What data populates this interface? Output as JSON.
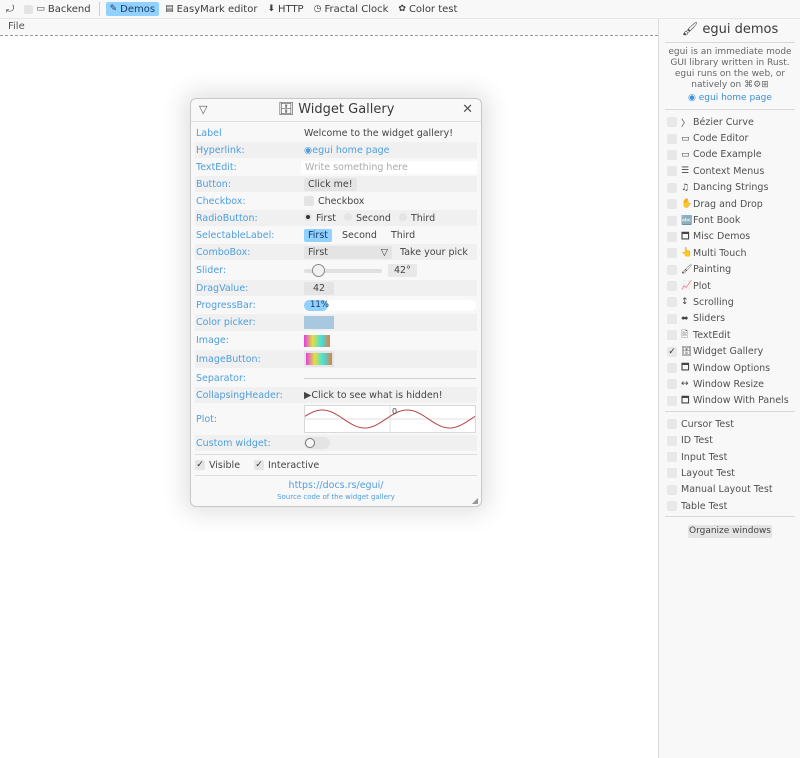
{
  "topbar": {
    "undo_icon": "undo-icon",
    "items": [
      {
        "label": "Backend",
        "icon": "laptop-icon"
      },
      {
        "label": "Demos",
        "icon": "tag-icon",
        "active": true
      },
      {
        "label": "EasyMark editor",
        "icon": "doc-icon"
      },
      {
        "label": "HTTP",
        "icon": "download-icon"
      },
      {
        "label": "Fractal Clock",
        "icon": "clock-icon"
      },
      {
        "label": "Color test",
        "icon": "palette-icon"
      }
    ]
  },
  "menubar": {
    "file": "File"
  },
  "sidepanel": {
    "title": "egui demos",
    "desc1": "egui is an immediate mode",
    "desc2": "GUI library written in Rust.",
    "desc3": "egui runs on the web, or",
    "desc4": "natively on",
    "link": "egui home page",
    "demos": [
      {
        "icon": "〉",
        "label": "Bézier Curve",
        "checked": false
      },
      {
        "icon": "▭",
        "label": "Code Editor",
        "checked": false
      },
      {
        "icon": "▭",
        "label": "Code Example",
        "checked": false
      },
      {
        "icon": "☰",
        "label": "Context Menus",
        "checked": false
      },
      {
        "icon": "♫",
        "label": "Dancing Strings",
        "checked": false
      },
      {
        "icon": "✋",
        "label": "Drag and Drop",
        "checked": false
      },
      {
        "icon": "🔤",
        "label": "Font Book",
        "checked": false
      },
      {
        "icon": "🗖",
        "label": "Misc Demos",
        "checked": false
      },
      {
        "icon": "👆",
        "label": "Multi Touch",
        "checked": false
      },
      {
        "icon": "🖌",
        "label": "Painting",
        "checked": false
      },
      {
        "icon": "📈",
        "label": "Plot",
        "checked": false
      },
      {
        "icon": "↕",
        "label": "Scrolling",
        "checked": false
      },
      {
        "icon": "⬌",
        "label": "Sliders",
        "checked": false
      },
      {
        "icon": "🖹",
        "label": "TextEdit",
        "checked": false
      },
      {
        "icon": "🗄",
        "label": "Widget Gallery",
        "checked": true
      },
      {
        "icon": "🗖",
        "label": "Window Options",
        "checked": false
      },
      {
        "icon": "↔",
        "label": "Window Resize",
        "checked": false
      },
      {
        "icon": "🗖",
        "label": "Window With Panels",
        "checked": false
      }
    ],
    "tests": [
      {
        "label": "Cursor Test"
      },
      {
        "label": "ID Test"
      },
      {
        "label": "Input Test"
      },
      {
        "label": "Layout Test"
      },
      {
        "label": "Manual Layout Test"
      },
      {
        "label": "Table Test"
      }
    ],
    "organize": "Organize windows"
  },
  "gallery": {
    "title": "Widget Gallery",
    "rows": {
      "label": {
        "name": "Label",
        "value": "Welcome to the widget gallery!"
      },
      "hyperlink": {
        "name": "Hyperlink:",
        "value": "egui home page"
      },
      "textedit": {
        "name": "TextEdit:",
        "placeholder": "Write something here"
      },
      "button": {
        "name": "Button:",
        "value": "Click me!"
      },
      "checkbox": {
        "name": "Checkbox:",
        "value": "Checkbox"
      },
      "radio": {
        "name": "RadioButton:",
        "options": [
          "First",
          "Second",
          "Third"
        ],
        "selected": 0
      },
      "selectable": {
        "name": "SelectableLabel:",
        "options": [
          "First",
          "Second",
          "Third"
        ],
        "selected": 0
      },
      "combo": {
        "name": "ComboBox:",
        "value": "First",
        "extra": "Take your pick"
      },
      "slider": {
        "name": "Slider:",
        "value": "42°",
        "fraction": 0.117
      },
      "dragvalue": {
        "name": "DragValue:",
        "value": "42"
      },
      "progress": {
        "name": "ProgressBar:",
        "value": "11%",
        "fraction": 0.11
      },
      "colorpicker": {
        "name": "Color picker:"
      },
      "image": {
        "name": "Image:"
      },
      "imagebutton": {
        "name": "ImageButton:"
      },
      "separator": {
        "name": "Separator:"
      },
      "collapsing": {
        "name": "CollapsingHeader:",
        "value": "Click to see what is hidden!"
      },
      "plot": {
        "name": "Plot:",
        "label": "0"
      },
      "custom": {
        "name": "Custom widget:"
      }
    },
    "visible": "Visible",
    "interactive": "Interactive",
    "footer_link": "https://docs.rs/egui/",
    "footer_src": "Source code of the widget gallery"
  }
}
